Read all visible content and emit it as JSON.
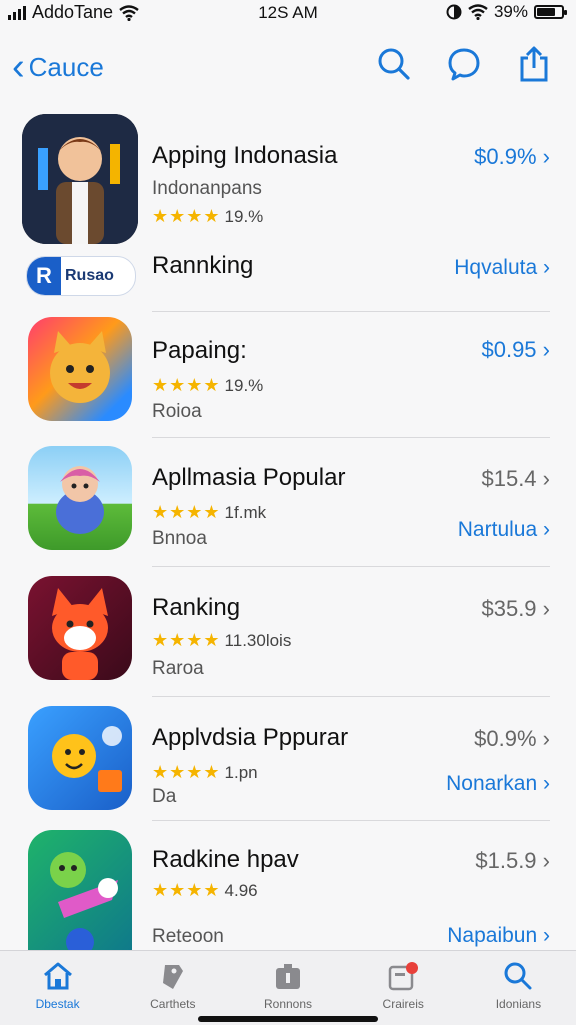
{
  "status": {
    "carrier": "AddoTane",
    "time": "12S AM",
    "battery": "39%"
  },
  "nav": {
    "back_label": "Cauce"
  },
  "rows": [
    {
      "title": "Apping Indonasia",
      "subtitle": "Indonanpans",
      "rating_text": "19.%",
      "price": "$0.9%",
      "price_color": "blue"
    },
    {
      "title": "Rannking",
      "badge_text": "Rusao",
      "action": "Hqvaluta"
    },
    {
      "title": "Papaing:",
      "rating_text": "19.%",
      "subtitle": "Roioa",
      "price": "$0.95",
      "price_color": "blue"
    },
    {
      "title": "Apllmasia Popular",
      "rating_text": "1f.mk",
      "subtitle": "Bnnoa",
      "price": "$15.4",
      "price_color": "gray",
      "action": "Nartulua"
    },
    {
      "title": "Ranking",
      "rating_text": "11.30lois",
      "subtitle": "Raroa",
      "price": "$35.9",
      "price_color": "gray"
    },
    {
      "title": "Applvdsia Pppurar",
      "rating_text": "1.pn",
      "subtitle": "Da",
      "price": "$0.9%",
      "price_color": "gray",
      "action": "Nonarkan"
    },
    {
      "title": "Radkine hpav",
      "rating_text": "4.96",
      "subtitle": "Reteoon",
      "price": "$1.5.9",
      "price_color": "gray",
      "action": "Napaibun"
    }
  ],
  "tabs": [
    {
      "label": "Dbestak",
      "icon": "home-icon",
      "active": true
    },
    {
      "label": "Carthets",
      "icon": "tag-icon"
    },
    {
      "label": "Ronnons",
      "icon": "box-icon"
    },
    {
      "label": "Craireis",
      "icon": "notification-icon"
    },
    {
      "label": "Idonians",
      "icon": "search-icon"
    }
  ],
  "colors": {
    "accent": "#1a78d8",
    "star": "#f5b400"
  }
}
